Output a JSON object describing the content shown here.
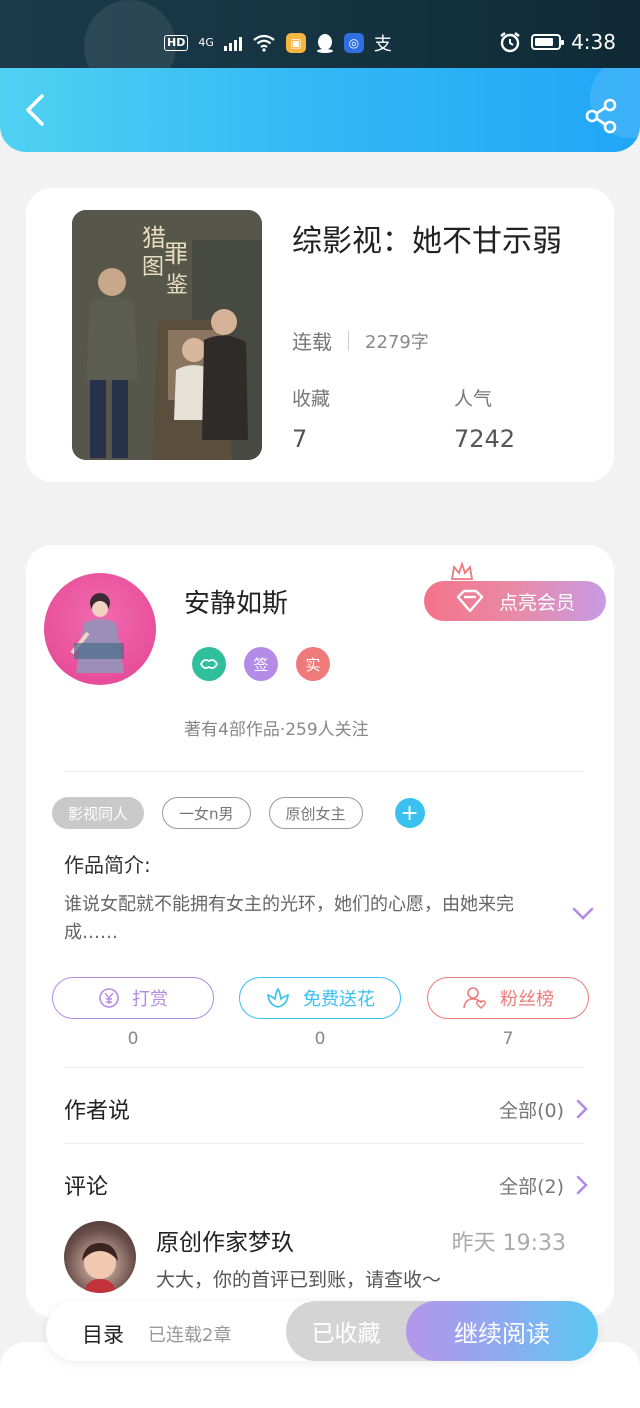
{
  "status_bar": {
    "hd": "HD",
    "network": "4G",
    "alipay": "支",
    "time": "4:38"
  },
  "book": {
    "title": "综影视：她不甘示弱",
    "status": "连载",
    "word_count": "2279字",
    "favorites_label": "收藏",
    "favorites_value": "7",
    "popularity_label": "人气",
    "popularity_value": "7242"
  },
  "author": {
    "name": "安静如斯",
    "vip_button": "点亮会员",
    "badges": [
      "签",
      "实"
    ],
    "works_line": "著有4部作品·259人关注"
  },
  "tags": [
    "影视同人",
    "一女n男",
    "原创女主"
  ],
  "intro": {
    "title": "作品简介:",
    "text": "谁说女配就不能拥有女主的光环，她们的心愿，由她来完成……"
  },
  "actions": [
    {
      "label": "打赏",
      "count": "0",
      "icon": "yuan-icon"
    },
    {
      "label": "免费送花",
      "count": "0",
      "icon": "flower-icon"
    },
    {
      "label": "粉丝榜",
      "count": "7",
      "icon": "fan-icon"
    }
  ],
  "author_says": {
    "title": "作者说",
    "more": "全部(0)"
  },
  "comments": {
    "title": "评论",
    "more": "全部(2)",
    "first": {
      "name": "原创作家梦玖",
      "time": "昨天 19:33",
      "text": "大大，你的首评已到账，请查收～"
    }
  },
  "bottom_bar": {
    "menu": "目录",
    "chapters": "已连载2章",
    "favorited": "已收藏",
    "continue": "继续阅读"
  },
  "colors": {
    "header_start": "#4fd2f2",
    "header_end": "#21a6f7",
    "accent_purple": "#b48be6",
    "accent_cyan": "#3ac1f0",
    "accent_red": "#ef7a7a"
  }
}
